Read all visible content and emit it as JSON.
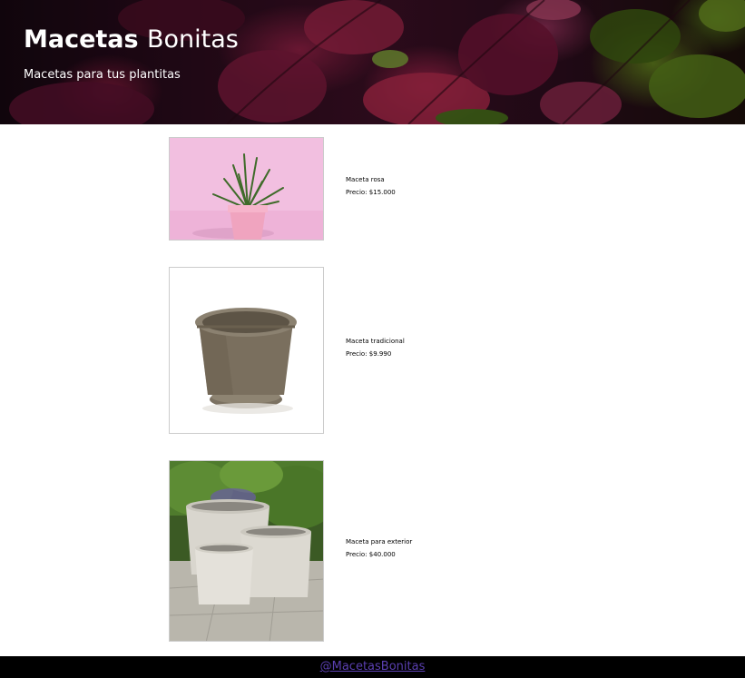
{
  "header": {
    "title_bold": "Macetas",
    "title_thin": "Bonitas",
    "subtitle": "Macetas para tus plantitas"
  },
  "products": [
    {
      "name": "Maceta rosa",
      "price": "Precio: $15.000"
    },
    {
      "name": "Maceta tradicional",
      "price": "Precio: $9.990"
    },
    {
      "name": "Maceta para exterior",
      "price": "Precio: $40.000"
    }
  ],
  "footer": {
    "link_text": "@MacetasBonitas"
  },
  "colors": {
    "footer_bg": "#000000",
    "footer_link": "#5a3fb0",
    "header_text": "#ffffff"
  }
}
